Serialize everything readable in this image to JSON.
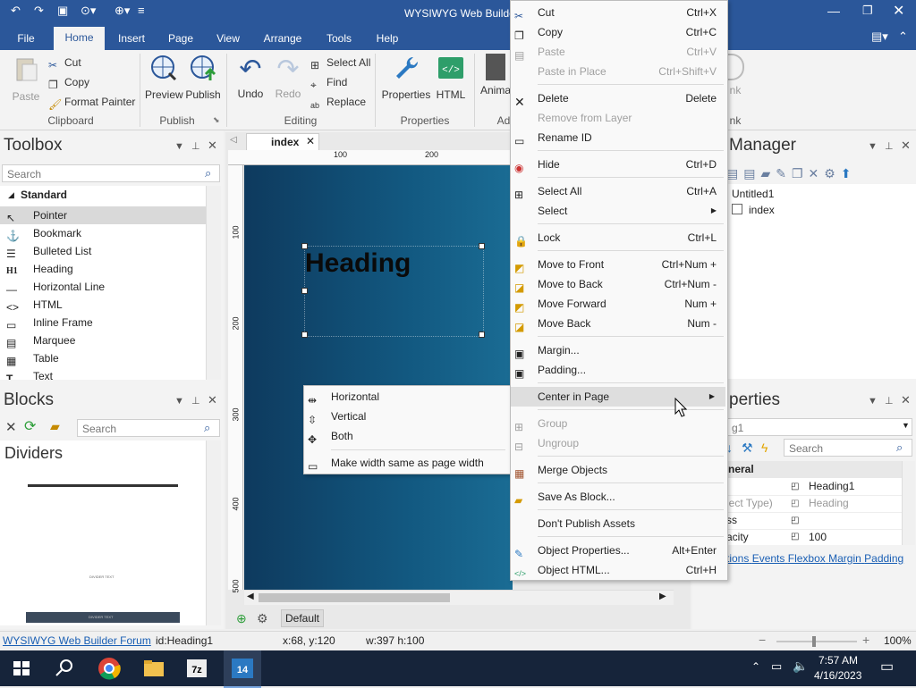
{
  "window": {
    "title": "WYSIWYG Web Builder"
  },
  "ribbon_tabs": [
    "File",
    "Home",
    "Insert",
    "Page",
    "View",
    "Arrange",
    "Tools",
    "Help"
  ],
  "ribbon": {
    "paste": "Paste",
    "cut": "Cut",
    "copy": "Copy",
    "format_painter": "Format Painter",
    "clipboard_group": "Clipboard",
    "preview": "Preview",
    "publish": "Publish",
    "publish_group": "Publish",
    "undo": "Undo",
    "redo": "Redo",
    "select_all": "Select All",
    "find": "Find",
    "replace": "Replace",
    "editing_group": "Editing",
    "properties": "Properties",
    "html": "HTML",
    "properties_group": "Properties",
    "animations_partial": "Anima",
    "group_partial": "Ad",
    "link_partial": "nk",
    "link_group_partial": "nk"
  },
  "toolbox": {
    "title": "Toolbox",
    "search_placeholder": "Search",
    "category": "Standard",
    "items": [
      "Pointer",
      "Bookmark",
      "Bulleted List",
      "Heading",
      "Horizontal Line",
      "HTML",
      "Inline Frame",
      "Marquee",
      "Table",
      "Text"
    ]
  },
  "blocks": {
    "title": "Blocks",
    "search_placeholder": "Search",
    "category": "Dividers",
    "preview_caption_1": "DIVIDER TEXT",
    "preview_caption_2": "DIVIDER TEXT"
  },
  "document": {
    "tab": "index",
    "ruler_top": [
      "100",
      "200"
    ],
    "ruler_left": [
      "100",
      "200",
      "300",
      "400",
      "500"
    ],
    "heading_text": "Heading",
    "bottom_label": "Default"
  },
  "site_manager": {
    "title_partial": "Manager",
    "tree": [
      {
        "label": "Untitled1"
      },
      {
        "label": "index"
      }
    ]
  },
  "properties": {
    "title_partial": "perties",
    "selector_partial": "g1",
    "search_placeholder": "Search",
    "section": "neral",
    "rows": [
      {
        "name": "",
        "value": "Heading1"
      },
      {
        "name": "ject Type)",
        "value": "Heading"
      },
      {
        "name": "ss",
        "value": ""
      },
      {
        "name": "acity",
        "value": "100"
      }
    ],
    "links": [
      "tions",
      "Events",
      "Flexbox",
      "Margin",
      "Padding"
    ]
  },
  "context_menu": {
    "items": [
      {
        "label": "Cut",
        "shortcut": "Ctrl+X",
        "icon": "scissors-icon",
        "enabled": true
      },
      {
        "label": "Copy",
        "shortcut": "Ctrl+C",
        "icon": "copy-icon",
        "enabled": true
      },
      {
        "label": "Paste",
        "shortcut": "Ctrl+V",
        "icon": "paste-icon",
        "enabled": false
      },
      {
        "label": "Paste in Place",
        "shortcut": "Ctrl+Shift+V",
        "icon": "",
        "enabled": false
      },
      {
        "label": "Delete",
        "shortcut": "Delete",
        "icon": "delete-icon",
        "enabled": true
      },
      {
        "label": "Remove from Layer",
        "shortcut": "",
        "icon": "",
        "enabled": false
      },
      {
        "label": "Rename ID",
        "shortcut": "",
        "icon": "rename-icon",
        "enabled": true
      },
      {
        "label": "Hide",
        "shortcut": "Ctrl+D",
        "icon": "hide-icon",
        "enabled": true
      },
      {
        "label": "Select All",
        "shortcut": "Ctrl+A",
        "icon": "select-all-icon",
        "enabled": true
      },
      {
        "label": "Select",
        "shortcut": "",
        "icon": "",
        "enabled": true
      },
      {
        "label": "Lock",
        "shortcut": "Ctrl+L",
        "icon": "lock-icon",
        "enabled": true
      },
      {
        "label": "Move to Front",
        "shortcut": "Ctrl+Num +",
        "icon": "front-icon",
        "enabled": true
      },
      {
        "label": "Move to Back",
        "shortcut": "Ctrl+Num -",
        "icon": "back-icon",
        "enabled": true
      },
      {
        "label": "Move Forward",
        "shortcut": "Num +",
        "icon": "forward-icon",
        "enabled": true
      },
      {
        "label": "Move Back",
        "shortcut": "Num -",
        "icon": "backward-icon",
        "enabled": true
      },
      {
        "label": "Margin...",
        "shortcut": "",
        "icon": "margin-icon",
        "enabled": true
      },
      {
        "label": "Padding...",
        "shortcut": "",
        "icon": "padding-icon",
        "enabled": true
      },
      {
        "label": "Center in Page",
        "shortcut": "",
        "icon": "",
        "enabled": true
      },
      {
        "label": "Group",
        "shortcut": "",
        "icon": "group-icon",
        "enabled": false
      },
      {
        "label": "Ungroup",
        "shortcut": "",
        "icon": "ungroup-icon",
        "enabled": false
      },
      {
        "label": "Merge Objects",
        "shortcut": "",
        "icon": "merge-icon",
        "enabled": true
      },
      {
        "label": "Save As Block...",
        "shortcut": "",
        "icon": "block-icon",
        "enabled": true
      },
      {
        "label": "Don't Publish Assets",
        "shortcut": "",
        "icon": "",
        "enabled": true
      },
      {
        "label": "Object Properties...",
        "shortcut": "Alt+Enter",
        "icon": "properties-icon",
        "enabled": true
      },
      {
        "label": "Object HTML...",
        "shortcut": "Ctrl+H",
        "icon": "html-icon",
        "enabled": true
      }
    ]
  },
  "submenu": {
    "items": [
      "Horizontal",
      "Vertical",
      "Both",
      "Make width same as page width"
    ]
  },
  "statusbar": {
    "forum_link": "WYSIWYG Web Builder Forum",
    "object_id": "id:Heading1",
    "coords": "x:68, y:120",
    "size": "w:397 h:100",
    "zoom": "100%"
  },
  "taskbar": {
    "time": "7:57 AM",
    "date": "4/16/2023"
  },
  "colors": {
    "accent": "#2b579a",
    "canvas": "#125880",
    "taskbar": "#16243a"
  }
}
